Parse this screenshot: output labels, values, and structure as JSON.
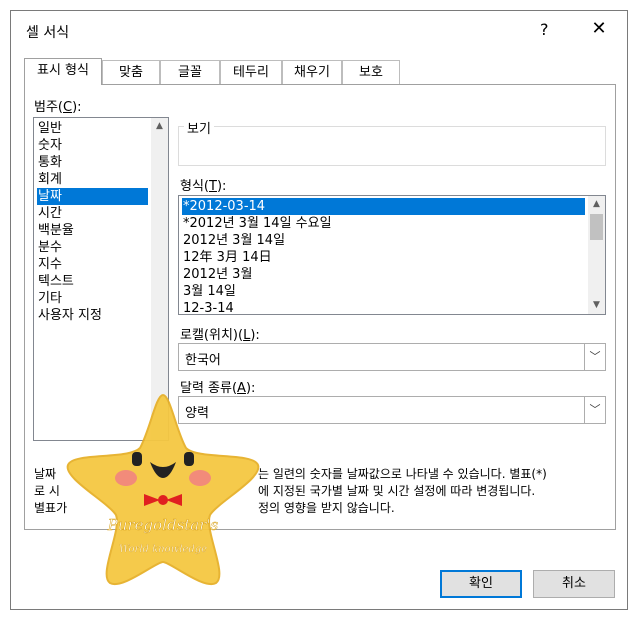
{
  "window": {
    "title": "셀 서식",
    "help_label": "?",
    "close_label": "✕"
  },
  "tabs": [
    {
      "label": "표시 형식",
      "active": true
    },
    {
      "label": "맞춤"
    },
    {
      "label": "글꼴"
    },
    {
      "label": "테두리"
    },
    {
      "label": "채우기"
    },
    {
      "label": "보호"
    }
  ],
  "category": {
    "label": "범주(C):",
    "items": [
      "일반",
      "숫자",
      "통화",
      "회계",
      "날짜",
      "시간",
      "백분율",
      "분수",
      "지수",
      "텍스트",
      "기타",
      "사용자 지정"
    ],
    "selected": "날짜"
  },
  "preview": {
    "label": "보기"
  },
  "format": {
    "label": "형식(T):",
    "items": [
      "*2012-03-14",
      "*2012년 3월 14일 수요일",
      "2012년 3월 14일",
      "12年 3月 14日",
      "2012년 3월",
      "3월 14일",
      "12-3-14"
    ],
    "selected": "*2012-03-14"
  },
  "locale": {
    "label": "로캘(위치)(L):",
    "value": "한국어"
  },
  "calendar": {
    "label": "달력 종류(A):",
    "value": "양력"
  },
  "description": {
    "line1_a": "날짜",
    "line1_b": "는 일련의 숫자를 날짜값으로 나타낼 수 있습니다. 별표(*)",
    "line2_a": "로 시",
    "line2_b": "에 지정된 국가별 날짜 및 시간 설정에 따라 변경됩니다.",
    "line3_a": "별표가",
    "line3_b": "정의 영향을 받지 않습니다."
  },
  "watermark": {
    "line1": "Puregoldstar's",
    "line2": "World knowledge"
  },
  "buttons": {
    "ok": "확인",
    "cancel": "취소"
  },
  "colors": {
    "selection": "#0078d7",
    "star": "#f5c842"
  }
}
